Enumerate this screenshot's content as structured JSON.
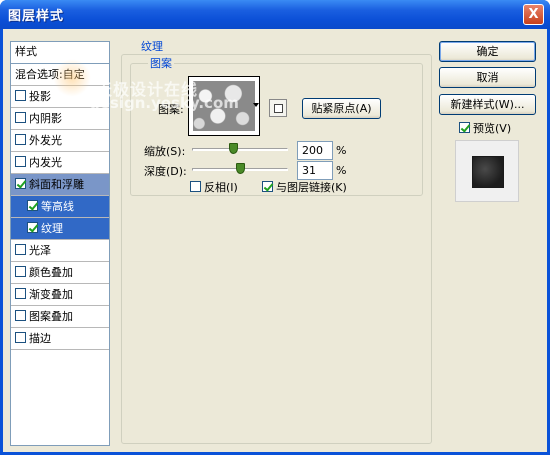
{
  "window": {
    "title": "图层样式",
    "close_glyph": "X"
  },
  "watermark": {
    "line1": "天极设计在线",
    "line2": "design.yesky.com"
  },
  "style_list": {
    "header": "样式",
    "items": [
      {
        "label": "混合选项:自定",
        "checkbox": false,
        "checked": false,
        "state": "normal"
      },
      {
        "label": "投影",
        "checkbox": true,
        "checked": false,
        "state": "normal"
      },
      {
        "label": "内阴影",
        "checkbox": true,
        "checked": false,
        "state": "normal"
      },
      {
        "label": "外发光",
        "checkbox": true,
        "checked": false,
        "state": "normal"
      },
      {
        "label": "内发光",
        "checkbox": true,
        "checked": false,
        "state": "normal"
      },
      {
        "label": "斜面和浮雕",
        "checkbox": true,
        "checked": true,
        "state": "selected"
      },
      {
        "label": "等高线",
        "checkbox": true,
        "checked": true,
        "state": "sub-selected"
      },
      {
        "label": "纹理",
        "checkbox": true,
        "checked": true,
        "state": "sub-selected"
      },
      {
        "label": "光泽",
        "checkbox": true,
        "checked": false,
        "state": "normal"
      },
      {
        "label": "颜色叠加",
        "checkbox": true,
        "checked": false,
        "state": "normal"
      },
      {
        "label": "渐变叠加",
        "checkbox": true,
        "checked": false,
        "state": "normal"
      },
      {
        "label": "图案叠加",
        "checkbox": true,
        "checked": false,
        "state": "normal"
      },
      {
        "label": "描边",
        "checkbox": true,
        "checked": false,
        "state": "normal"
      }
    ]
  },
  "texture_panel": {
    "group_title": "纹理",
    "subgroup_title": "图案",
    "pattern_label": "图案:",
    "snap_button": "贴紧原点(A)",
    "scale_label": "缩放(S):",
    "scale_value": "200",
    "scale_unit": "%",
    "scale_level_percent": 200,
    "depth_label": "深度(D):",
    "depth_value": "31",
    "depth_unit": "%",
    "depth_level_percent": 31,
    "invert_label": "反相(I)",
    "invert_checked": false,
    "link_label": "与图层链接(K)",
    "link_checked": true
  },
  "right_panel": {
    "ok": "确定",
    "cancel": "取消",
    "new_style": "新建样式(W)...",
    "preview_label": "预览(V)",
    "preview_checked": true
  },
  "colors": {
    "titlebar": "#0a4acb",
    "dialog_bg": "#ece9d8",
    "selected_row": "#7a96c8",
    "subselected_row": "#3169c6",
    "legend_text": "#0046d5"
  }
}
